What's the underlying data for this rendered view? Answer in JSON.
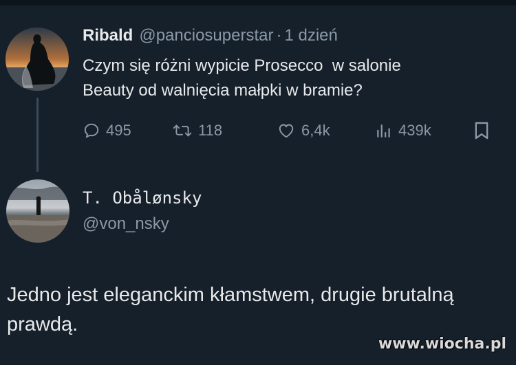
{
  "tweet": {
    "author_name": "Ribald",
    "author_handle": "@panciosuperstar",
    "separator": "·",
    "time": "1 dzień",
    "text": "Czym się różni wypicie Prosecco  w salonie\nBeauty od walnięcia małpki w bramie?",
    "actions": {
      "reply_icon": "reply-icon",
      "replies": "495",
      "retweet_icon": "retweet-icon",
      "retweets": "118",
      "like_icon": "heart-icon",
      "likes": "6,4k",
      "views_icon": "views-chart-icon",
      "views": "439k",
      "bookmark_icon": "bookmark-icon"
    }
  },
  "reply": {
    "author_name": "T. Obålønsky",
    "author_handle": "@von_nsky",
    "text": "Jedno jest eleganckim kłamstwem, drugie brutalną prawdą."
  },
  "watermark": "www.wiocha.pl",
  "colors": {
    "background": "#15202b",
    "text": "#e7e9ea",
    "muted": "#8b98a5"
  }
}
